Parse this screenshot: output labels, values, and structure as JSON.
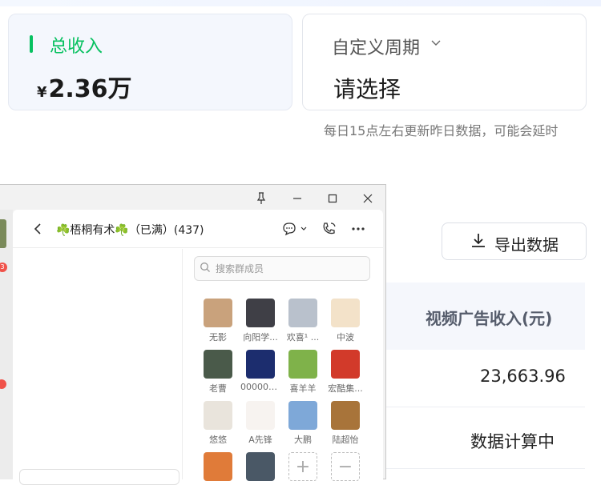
{
  "income": {
    "title": "总收入",
    "currency": "¥",
    "value": "2.36万"
  },
  "period": {
    "title": "自定义周期",
    "value": "请选择"
  },
  "note": "每日15点左右更新昨日数据，可能会延时",
  "export": {
    "label": "导出数据"
  },
  "table": {
    "column_header": "视频广告收入(元)",
    "rows": [
      "23,663.96",
      "数据计算中"
    ]
  },
  "chat": {
    "left_badge": "3",
    "title": "☘️梧桐有术☘️（已满）(437)",
    "search_placeholder": "搜索群成员",
    "members": [
      {
        "name": "无影",
        "color": "#c9a27c"
      },
      {
        "name": "向阳学...",
        "color": "#3f3f46"
      },
      {
        "name": "欢喜¹ ...",
        "color": "#b9c1cc"
      },
      {
        "name": "中波",
        "color": "#f3e2c9"
      },
      {
        "name": "老曹",
        "color": "#4a5a4a"
      },
      {
        "name": "000000...",
        "color": "#1c2d6e"
      },
      {
        "name": "喜羊羊",
        "color": "#7fb24a"
      },
      {
        "name": "宏酷集...",
        "color": "#d23a2a"
      },
      {
        "name": "悠悠",
        "color": "#e9e4dc"
      },
      {
        "name": "A先锋",
        "color": "#f7f3f0"
      },
      {
        "name": "大鹏",
        "color": "#7ea8d8"
      },
      {
        "name": "陆超怡",
        "color": "#a8743a"
      },
      {
        "name": "",
        "color": "#e07b39"
      },
      {
        "name": "",
        "color": "#4a5866"
      }
    ],
    "add_symbol": "+",
    "remove_symbol": "−"
  },
  "colors": {
    "accent": "#07c160",
    "badge": "#f0524a"
  }
}
